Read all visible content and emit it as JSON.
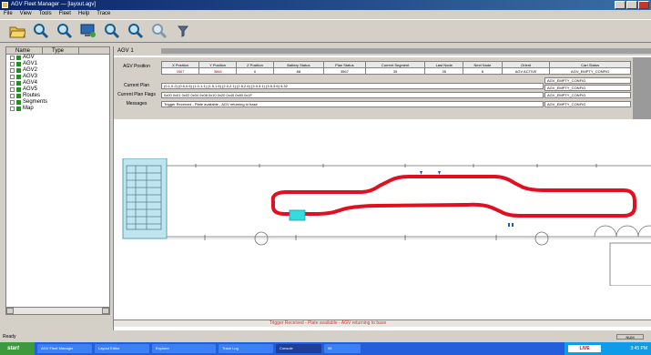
{
  "window": {
    "title": "AGV Fleet Manager — [layout.agv]"
  },
  "menu": [
    "File",
    "View",
    "Tools",
    "Fleet",
    "Help",
    "Trace"
  ],
  "tree": {
    "headers": [
      "Name",
      "Type"
    ],
    "items": [
      "AGV",
      "AGV1",
      "AGV2",
      "AGV3",
      "AGV4",
      "AGV5",
      "Routes",
      "Segments",
      "Map"
    ]
  },
  "main": {
    "tab": "AGV 1",
    "row_labels": [
      "AGV Position",
      "Current Plan",
      "Current Plan Flags",
      "Messages"
    ],
    "columns": [
      "X Position",
      "Y Position",
      "Z Position",
      "Battery Status",
      "Plan Status",
      "Current Segment",
      "Last Node",
      "Next Node",
      "Orient",
      "Cart Status"
    ],
    "values": [
      "3567",
      "3868",
      "0",
      "88",
      "3567",
      "35",
      "35",
      "6",
      "AGV ACTIVE",
      "AGV_EMPTY_CONFIG"
    ],
    "plan_text": "(0.1,0.2) (0.5,0.6) (1.0,1.1) (1.5,1.6) (2.0,2.1) (2.5,2.6) (3.0,3.1) (3.5,3.6) 5.32",
    "flags_text": "0x00 0x01 0x02 0x04 0x08 0x10 0x20 0x40 0x80 0x1F",
    "message_text": "Trigger Received - Plate available - AGV returning to base",
    "status_lines": [
      "AGV_EMPTY_CONFIG",
      "AGV_EMPTY_CONFIG",
      "AGV_EMPTY_CONFIG",
      "AGV_EMPTY_CONFIG"
    ]
  },
  "bottom_message": "Trigger Received - Plate available - AGV returning to base",
  "statusbar": {
    "left": "Ready",
    "right": "NUM"
  },
  "taskbar": {
    "start": "start",
    "tasks": [
      "AGV Fleet Manager",
      "Layout Editor",
      "Explorer",
      "Trace Log",
      "Console",
      "58"
    ],
    "clock": "3:45 PM",
    "indicator": "LIVE"
  },
  "colors": {
    "track": "#e01020",
    "agv": "#33dddd",
    "title_bar": "#0a246a"
  }
}
